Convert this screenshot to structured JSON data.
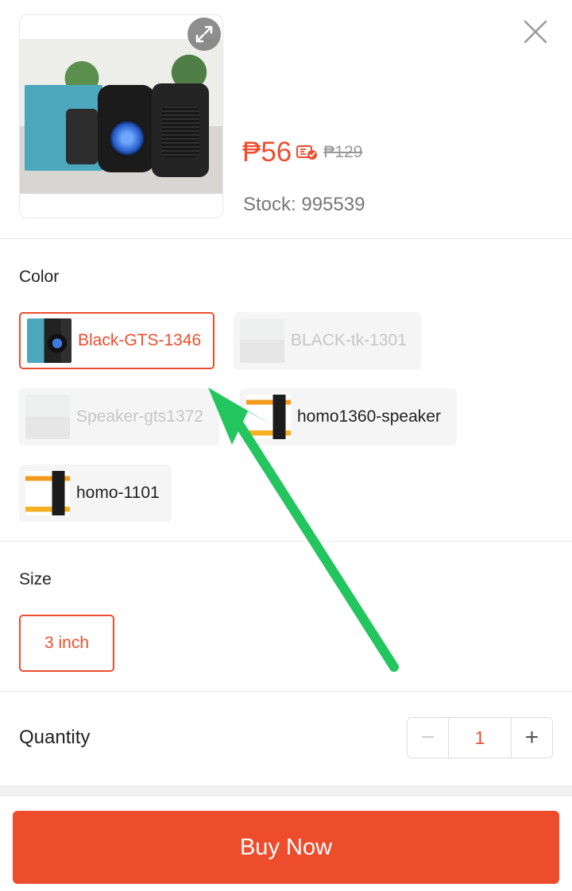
{
  "product": {
    "image_alt": "speaker product image",
    "price": "₱56",
    "original_price": "₱129",
    "stock_text": "Stock: 995539",
    "expand_icon": "expand-icon",
    "close_icon": "close-icon",
    "voucher_icon": "voucher-icon"
  },
  "color": {
    "label": "Color",
    "options": [
      {
        "label": "Black-GTS-1346",
        "state": "selected"
      },
      {
        "label": "BLACK-tk-1301",
        "state": "disabled"
      },
      {
        "label": "Speaker-gts1372",
        "state": "disabled"
      },
      {
        "label": "homo1360-speaker",
        "state": "available"
      },
      {
        "label": "homo-1101",
        "state": "available"
      }
    ]
  },
  "size": {
    "label": "Size",
    "options": [
      {
        "label": "3 inch",
        "state": "selected"
      }
    ]
  },
  "quantity": {
    "label": "Quantity",
    "value": "1",
    "minus": "−",
    "plus": "+"
  },
  "actions": {
    "buy_now": "Buy Now"
  },
  "colors": {
    "accent": "#ee4d2d",
    "annotation_arrow": "#22c55e"
  }
}
